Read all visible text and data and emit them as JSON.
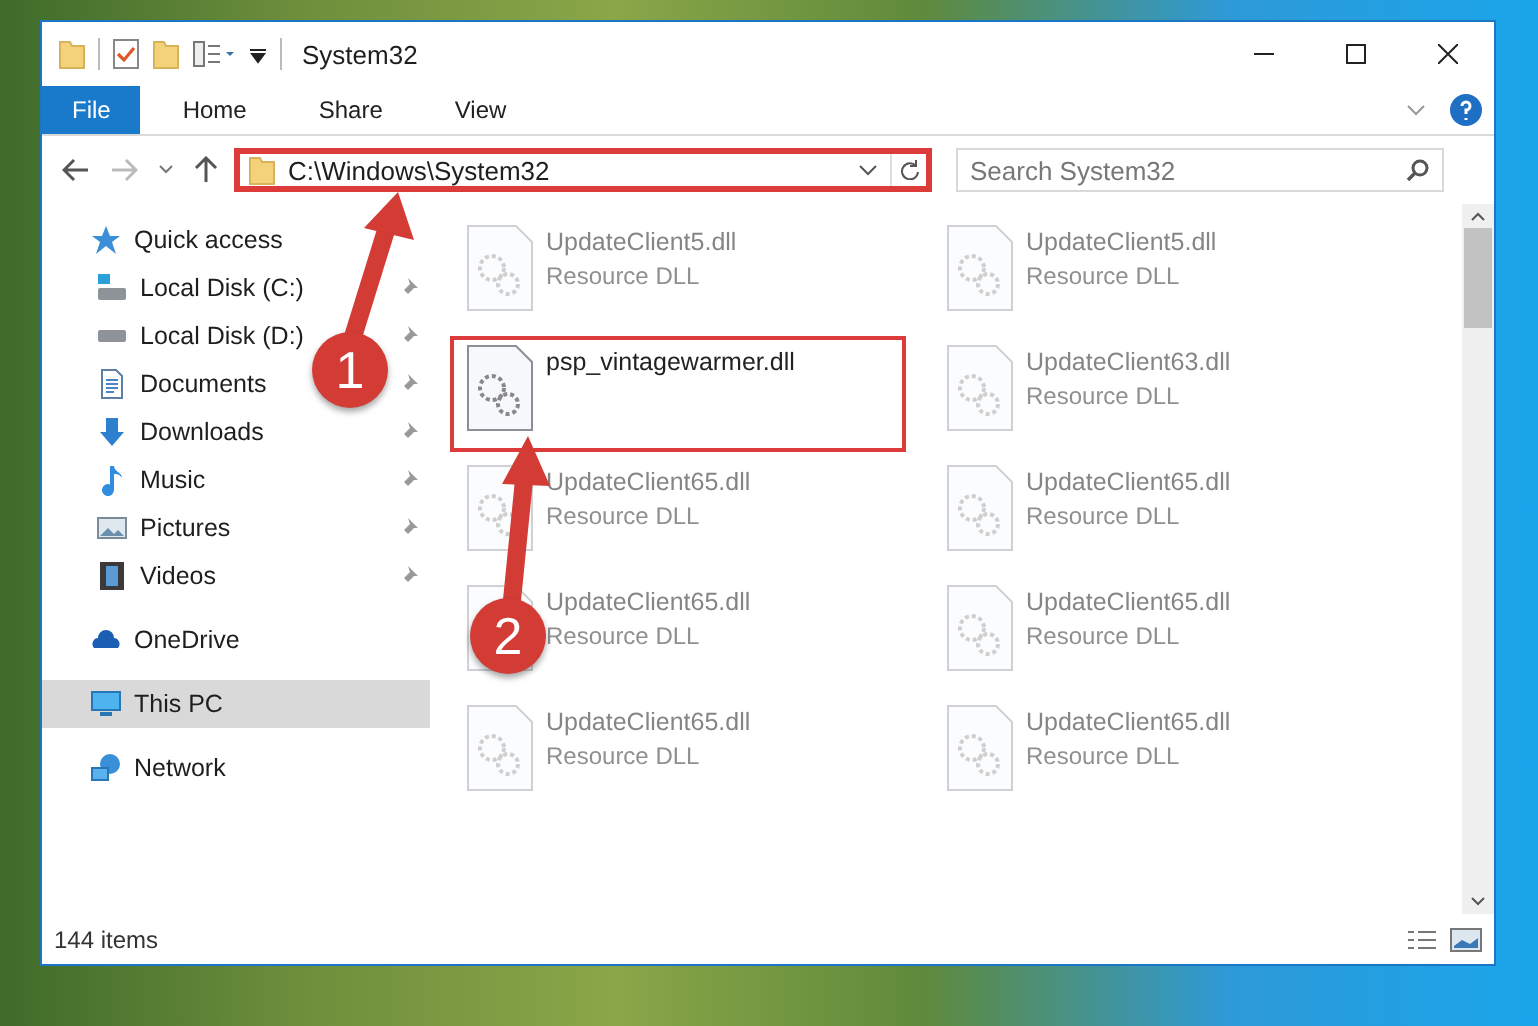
{
  "window": {
    "title": "System32"
  },
  "ribbon_tabs": [
    {
      "label": "File",
      "selected": true
    },
    {
      "label": "Home",
      "selected": false
    },
    {
      "label": "Share",
      "selected": false
    },
    {
      "label": "View",
      "selected": false
    }
  ],
  "address": {
    "path": "C:\\Windows\\System32",
    "highlighted": true
  },
  "search": {
    "placeholder": "Search System32"
  },
  "nav_items": [
    {
      "label": "Quick access",
      "kind": "star",
      "selected": false,
      "children": [
        {
          "label": "Local Disk (C:)",
          "kind": "drive-c",
          "pinned": true,
          "selected": false
        },
        {
          "label": "Local Disk (D:)",
          "kind": "drive",
          "pinned": true,
          "selected": false
        },
        {
          "label": "Documents",
          "kind": "documents",
          "pinned": true,
          "selected": false
        },
        {
          "label": "Downloads",
          "kind": "downloads",
          "pinned": true,
          "selected": false
        },
        {
          "label": "Music",
          "kind": "music",
          "pinned": true,
          "selected": false
        },
        {
          "label": "Pictures",
          "kind": "pictures",
          "pinned": true,
          "selected": false
        },
        {
          "label": "Videos",
          "kind": "videos",
          "pinned": true,
          "selected": false
        }
      ]
    },
    {
      "label": "OneDrive",
      "kind": "cloud",
      "selected": false
    },
    {
      "label": "This PC",
      "kind": "pc",
      "selected": true
    },
    {
      "label": "Network",
      "kind": "network",
      "selected": false
    }
  ],
  "files": [
    {
      "name": "UpdateClient5.dll",
      "type": "Resource DLL",
      "highlighted": false
    },
    {
      "name": "UpdateClient5.dll",
      "type": "Resource DLL",
      "highlighted": false
    },
    {
      "name": "psp_vintagewarmer.dll",
      "highlighted": true
    },
    {
      "name": "UpdateClient63.dll",
      "type": "Resource DLL",
      "highlighted": false
    },
    {
      "name": "UpdateClient65.dll",
      "type": "Resource DLL",
      "highlighted": false
    },
    {
      "name": "UpdateClient65.dll",
      "type": "Resource DLL",
      "highlighted": false
    },
    {
      "name": "UpdateClient65.dll",
      "type": "Resource DLL",
      "highlighted": false
    },
    {
      "name": "UpdateClient65.dll",
      "type": "Resource DLL",
      "highlighted": false
    },
    {
      "name": "UpdateClient65.dll",
      "type": "Resource DLL",
      "highlighted": false
    },
    {
      "name": "UpdateClient65.dll",
      "type": "Resource DLL",
      "highlighted": false
    }
  ],
  "status_bar": {
    "count": "144 items"
  },
  "callouts": [
    {
      "number": "1"
    },
    {
      "number": "2"
    }
  ]
}
